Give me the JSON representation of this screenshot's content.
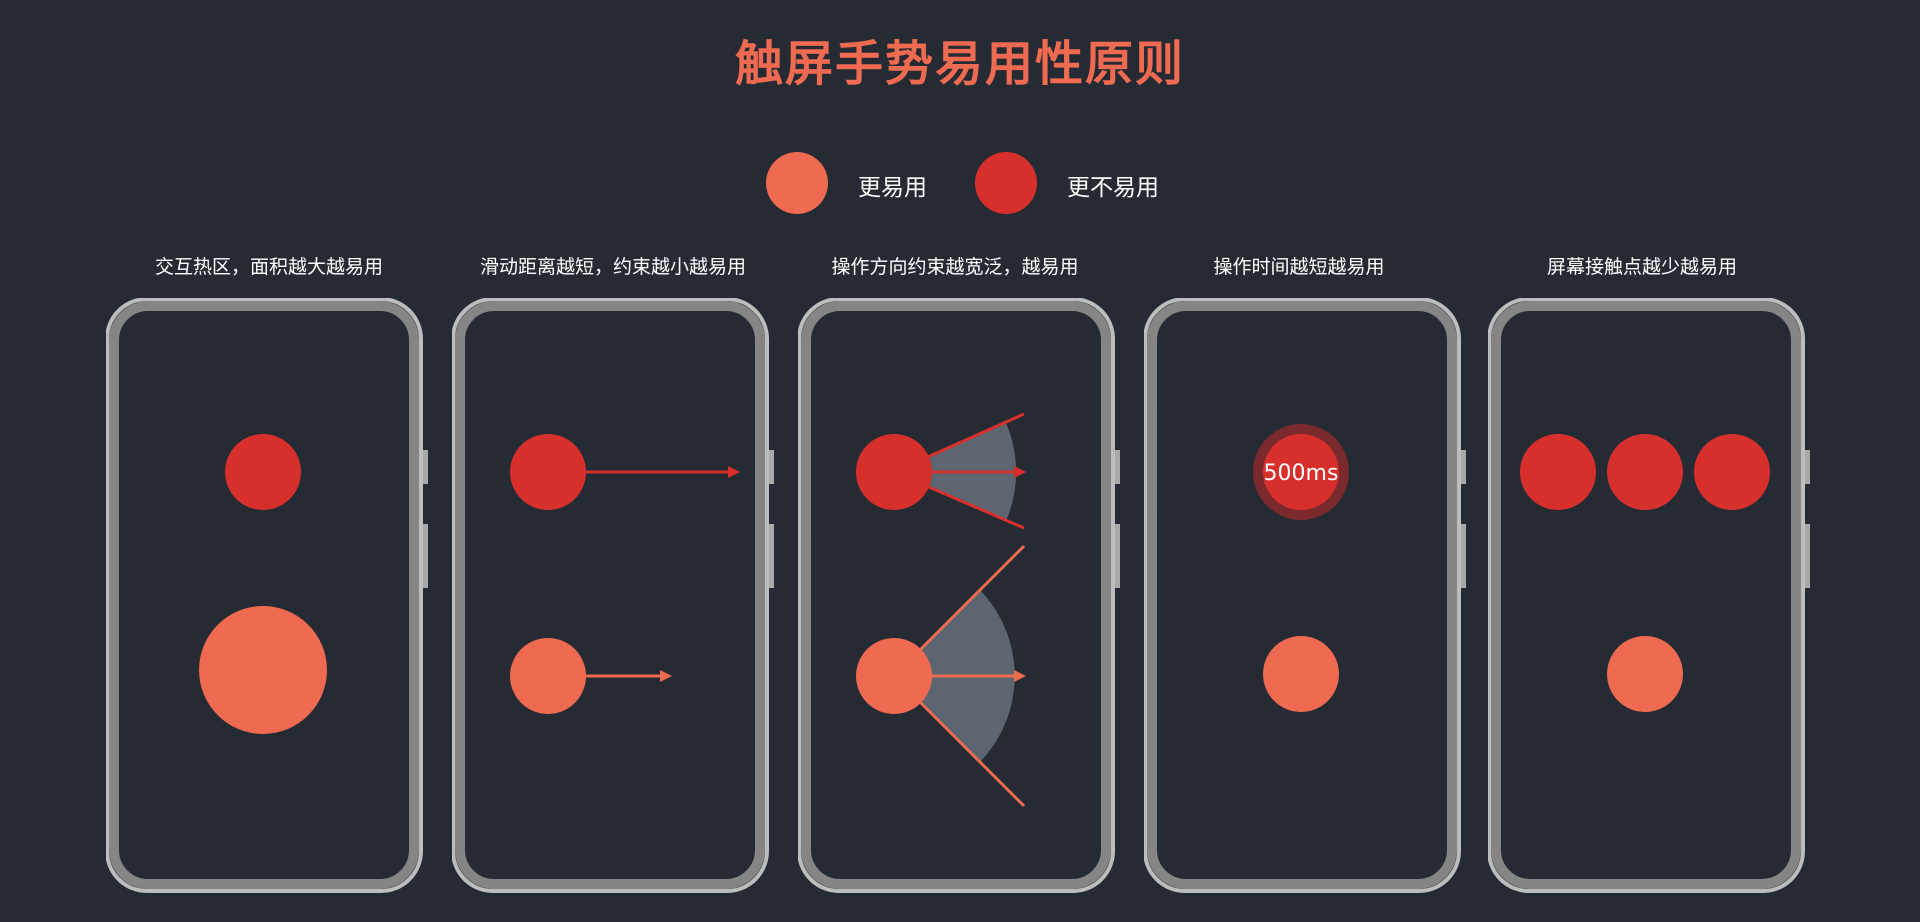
{
  "title": "触屏手势易用性原则",
  "legend": {
    "easy": {
      "label": "更易用",
      "color": "#ee6a50"
    },
    "hard": {
      "label": "更不易用",
      "color": "#d7302c"
    }
  },
  "panels": [
    {
      "caption": "交互热区，面积越大越易用"
    },
    {
      "caption": "滑动距离越短，约束越小越易用"
    },
    {
      "caption": "操作方向约束越宽泛，越易用"
    },
    {
      "caption": "操作时间越短越易用",
      "timer_label": "500ms"
    },
    {
      "caption": "屏幕接触点越少越易用"
    }
  ],
  "colors": {
    "background": "#262b33",
    "accent_easy": "#ee6a50",
    "accent_hard": "#d7302c",
    "fan": "#5d6570",
    "phone_frame": "#a9a9a9"
  }
}
